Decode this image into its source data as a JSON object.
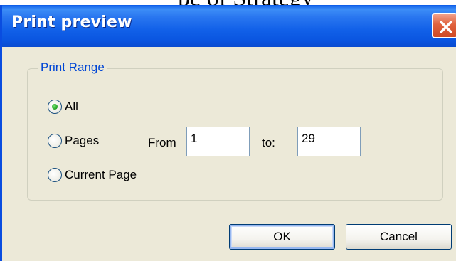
{
  "background_text": "pe of Strategy",
  "window": {
    "title": "Print preview"
  },
  "print_range": {
    "label": "Print Range",
    "options": [
      {
        "label": "All",
        "checked": true
      },
      {
        "label": "Pages",
        "checked": false
      },
      {
        "label": "Current Page",
        "checked": false
      }
    ],
    "from_label": "From",
    "from_value": "1",
    "to_label": "to:",
    "to_value": "29"
  },
  "buttons": {
    "ok": "OK",
    "cancel": "Cancel"
  },
  "colors": {
    "title_bar": "#0a55e0",
    "dialog_bg": "#ece9d8",
    "group_label": "#0046d5",
    "close": "#e0623d"
  }
}
